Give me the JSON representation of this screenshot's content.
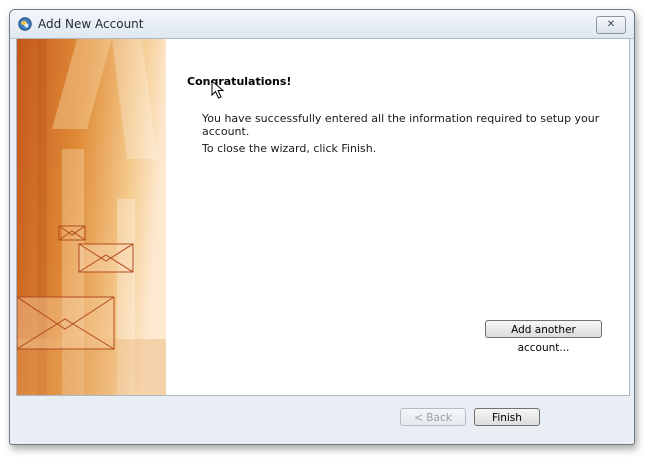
{
  "window": {
    "title": "Add New Account",
    "close_glyph": "✕"
  },
  "content": {
    "heading": "Congratulations!",
    "message1": "You have successfully entered all the information required to setup your account.",
    "message2": "To close the wizard, click Finish."
  },
  "buttons": {
    "add_account": "Add another account...",
    "back": "< Back",
    "finish": "Finish",
    "back_enabled": false
  },
  "icons": {
    "app": "outlook-icon",
    "banner": "envelope-banner-image",
    "close": "close-icon"
  },
  "colors": {
    "banner_dark": "#c8621e",
    "banner_light": "#fbe7cc",
    "dialog_bg": "#e9eef5"
  }
}
